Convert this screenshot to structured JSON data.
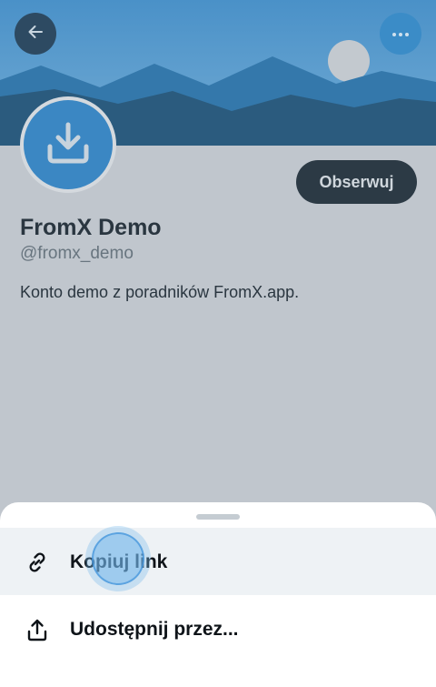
{
  "colors": {
    "sky_top": "#4a91c8",
    "sky_bottom": "#6aa5d1",
    "mountain_far": "#3176aa",
    "mountain_near": "#2c5d80",
    "page_dim": "#c0c6cd",
    "accent": "#3b87c3",
    "follow_button_bg": "#2c3a45"
  },
  "header": {
    "back_icon": "arrow-left-icon",
    "more_icon": "ellipsis-icon"
  },
  "profile": {
    "avatar_icon": "download-icon",
    "follow_label": "Obserwuj",
    "display_name": "FromX Demo",
    "handle": "@fromx_demo",
    "bio": "Konto demo z poradników FromX.app."
  },
  "share_sheet": {
    "items": [
      {
        "icon": "link-icon",
        "label": "Kopiuj link"
      },
      {
        "icon": "share-icon",
        "label": "Udostępnij przez..."
      }
    ]
  }
}
